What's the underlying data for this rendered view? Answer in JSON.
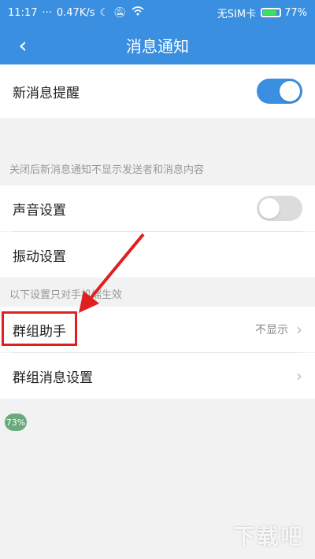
{
  "status": {
    "time": "11:17",
    "speed": "0.47K/s",
    "carrier": "无SIM卡",
    "battery": "77%",
    "battery_level": 0.77
  },
  "header": {
    "back_icon": "chevron-left-icon",
    "title": "消息通知"
  },
  "settings": {
    "new_msg": {
      "label": "新消息提醒",
      "enabled": true
    },
    "note1": "关闭后新消息通知不显示发送者和消息内容",
    "sound": {
      "label": "声音设置",
      "enabled": false
    },
    "vibration": {
      "label": "振动设置"
    },
    "note2": "以下设置只对手机端生效",
    "group_helper": {
      "label": "群组助手",
      "value": "不显示"
    },
    "group_msg": {
      "label": "群组消息设置"
    }
  },
  "badge": "73%",
  "watermark": "下载吧"
}
